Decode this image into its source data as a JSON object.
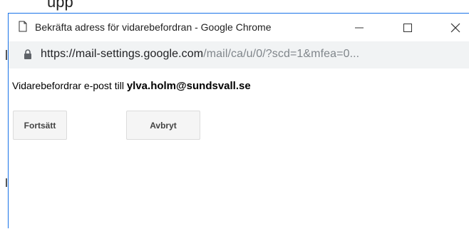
{
  "background": {
    "partial_text": "upp"
  },
  "window": {
    "title": "Bekräfta adress för vidarebefordran - Google Chrome",
    "controls": {
      "minimize": "—",
      "maximize": "☐",
      "close": "✕"
    }
  },
  "addressbar": {
    "url_domain": "https://mail-settings.google.com",
    "url_path": "/mail/ca/u/0/?scd=1&mfea=0..."
  },
  "content": {
    "message_prefix": "Vidarebefordrar e-post till ",
    "email": "ylva.holm@sundsvall.se",
    "continue_label": "Fortsätt",
    "cancel_label": "Avbryt"
  },
  "colors": {
    "accent_border": "#1a73e8",
    "addressbar_bg": "#f1f3f4",
    "button_bg": "#f5f5f5"
  }
}
